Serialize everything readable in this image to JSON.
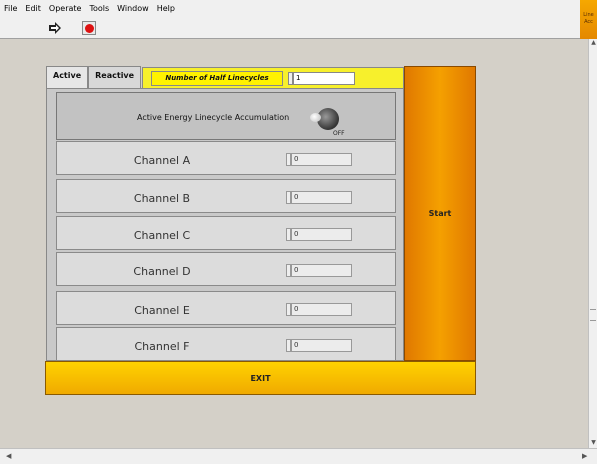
{
  "menu": [
    "File",
    "Edit",
    "Operate",
    "Tools",
    "Window",
    "Help"
  ],
  "corner_icon_text": [
    "Line",
    "Acc"
  ],
  "tabs": [
    "Active",
    "Reactive"
  ],
  "half_linecycles": {
    "label": "Number of Half Linecycles",
    "value": "1"
  },
  "accumulation": {
    "label": "Active Energy Linecycle Accumulation",
    "state": "OFF"
  },
  "channels": [
    {
      "name": "Channel A",
      "value": "0"
    },
    {
      "name": "Channel B",
      "value": "0"
    },
    {
      "name": "Channel C",
      "value": "0"
    },
    {
      "name": "Channel D",
      "value": "0"
    },
    {
      "name": "Channel E",
      "value": "0"
    },
    {
      "name": "Channel F",
      "value": "0"
    }
  ],
  "start_label": "Start",
  "exit_label": "EXIT",
  "colors": {
    "start": "#f0a000",
    "exit": "#ffcc00",
    "highlight": "#fff200",
    "stop": "#dd1111"
  }
}
